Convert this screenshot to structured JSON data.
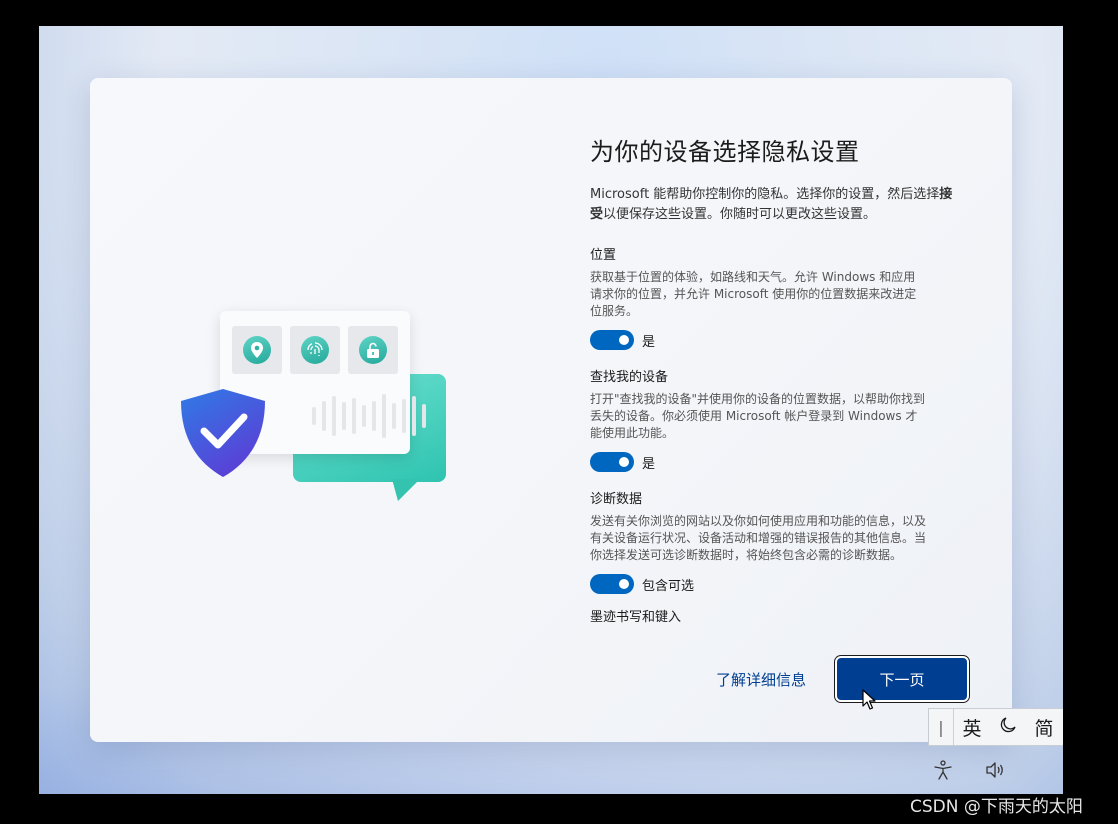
{
  "header": {
    "title": "为你的设备选择隐私设置",
    "intro_prefix": "Microsoft 能帮助你控制你的隐私。选择你的设置，然后选择",
    "intro_bold": "接受",
    "intro_suffix": "以便保存这些设置。你随时可以更改这些设置。"
  },
  "settings": [
    {
      "title": "位置",
      "description": "获取基于位置的体验，如路线和天气。允许 Windows 和应用请求你的位置，并允许 Microsoft 使用你的位置数据来改进定位服务。",
      "toggle_label": "是",
      "on": true
    },
    {
      "title": "查找我的设备",
      "description": "打开\"查找我的设备\"并使用你的设备的位置数据，以帮助你找到丢失的设备。你必须使用 Microsoft 帐户登录到 Windows 才能使用此功能。",
      "toggle_label": "是",
      "on": true
    },
    {
      "title": "诊断数据",
      "description": "发送有关你浏览的网站以及你如何使用应用和功能的信息，以及有关设备运行状况、设备活动和增强的错误报告的其他信息。当你选择发送可选诊断数据时，将始终包含必需的诊断数据。",
      "toggle_label": "包含可选",
      "on": true
    }
  ],
  "next_section_cut": "墨迹书写和键入",
  "footer": {
    "learn_more": "了解详细信息",
    "next_button": "下一页"
  },
  "ime": {
    "lang": "英",
    "mode_icon": "moon-icon",
    "script": "简"
  },
  "system_icons": [
    "accessibility-icon",
    "volume-icon"
  ],
  "watermark": "CSDN @下雨天的太阳",
  "colors": {
    "accent": "#0067c0",
    "primary_button": "#003e92",
    "teal": "#2ec4b0",
    "shield": "#3a5bd9"
  }
}
